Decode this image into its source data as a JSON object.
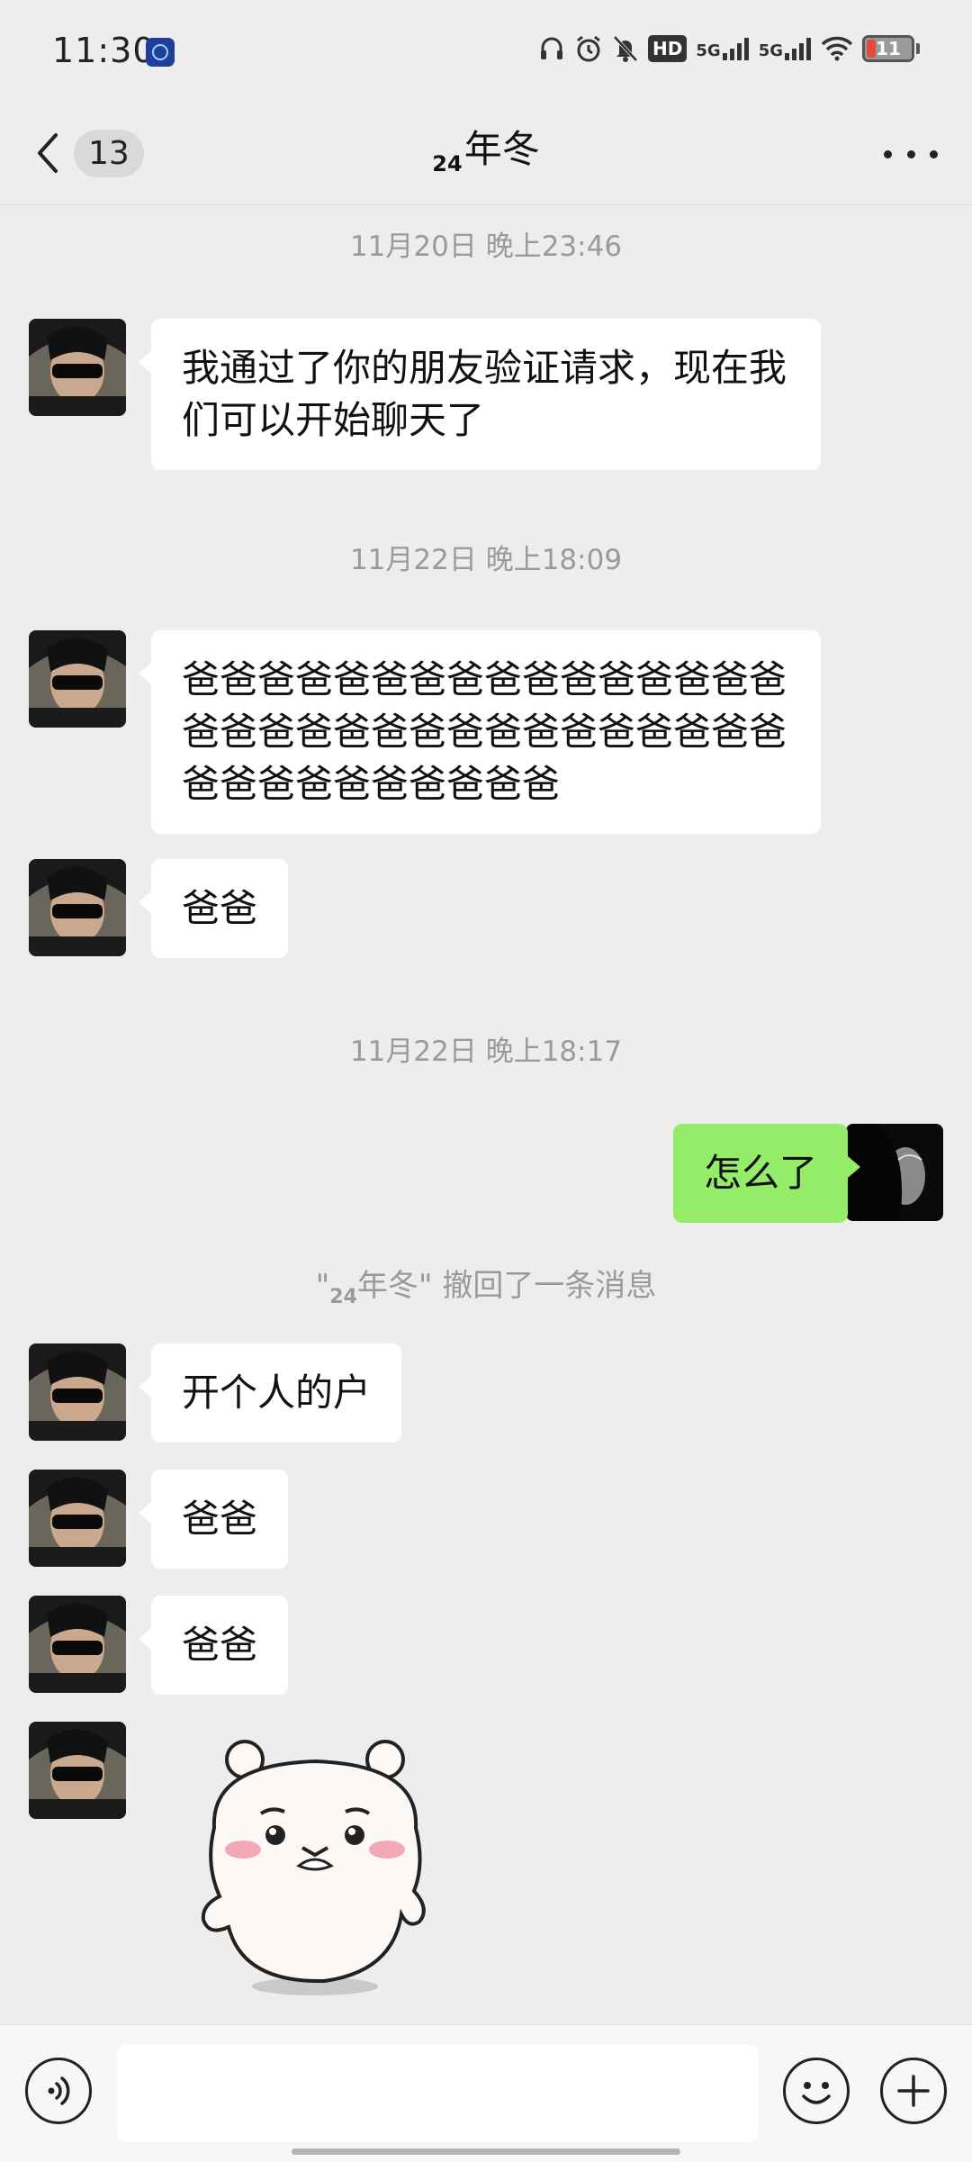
{
  "status_bar": {
    "time": "11:30",
    "hd_label": "HD",
    "net1": "5G",
    "net2": "5G",
    "battery": "11",
    "icons": [
      "app-badge-icon",
      "headphones-icon",
      "alarm-icon",
      "mute-icon",
      "hd-icon",
      "signal-5g-icon",
      "signal-5g-icon",
      "wifi-icon",
      "battery-icon"
    ]
  },
  "header": {
    "back_icon": "chevron-left-icon",
    "unread_count": "13",
    "title_sub": "24",
    "title_main": "年冬",
    "more_icon": "more-dots-icon"
  },
  "messages": {
    "ts1": "11月20日 晚上23:46",
    "m1": "我通过了你的朋友验证请求，现在我们可以开始聊天了",
    "ts2": "11月22日 晚上18:09",
    "m2": "爸爸爸爸爸爸爸爸爸爸爸爸爸爸爸爸爸爸爸爸爸爸爸爸爸爸爸爸爸爸爸爸爸爸爸爸爸爸爸爸爸爸",
    "m3": "爸爸",
    "ts3": "11月22日 晚上18:17",
    "m4": "怎么了",
    "recall_open": "\"",
    "recall_sub": "24",
    "recall_name": "年冬",
    "recall_rest": "\" 撤回了一条消息",
    "m5": "开个人的户",
    "m6": "爸爸",
    "m7": "爸爸",
    "sticker": "crying-bear-sticker"
  },
  "input_bar": {
    "voice_icon": "voice-icon",
    "emoji_icon": "emoji-icon",
    "plus_icon": "plus-icon",
    "value": ""
  },
  "colors": {
    "background": "#ededed",
    "bubble_in": "#ffffff",
    "bubble_out": "#95ec69",
    "timestamp": "#9a9a9a"
  }
}
